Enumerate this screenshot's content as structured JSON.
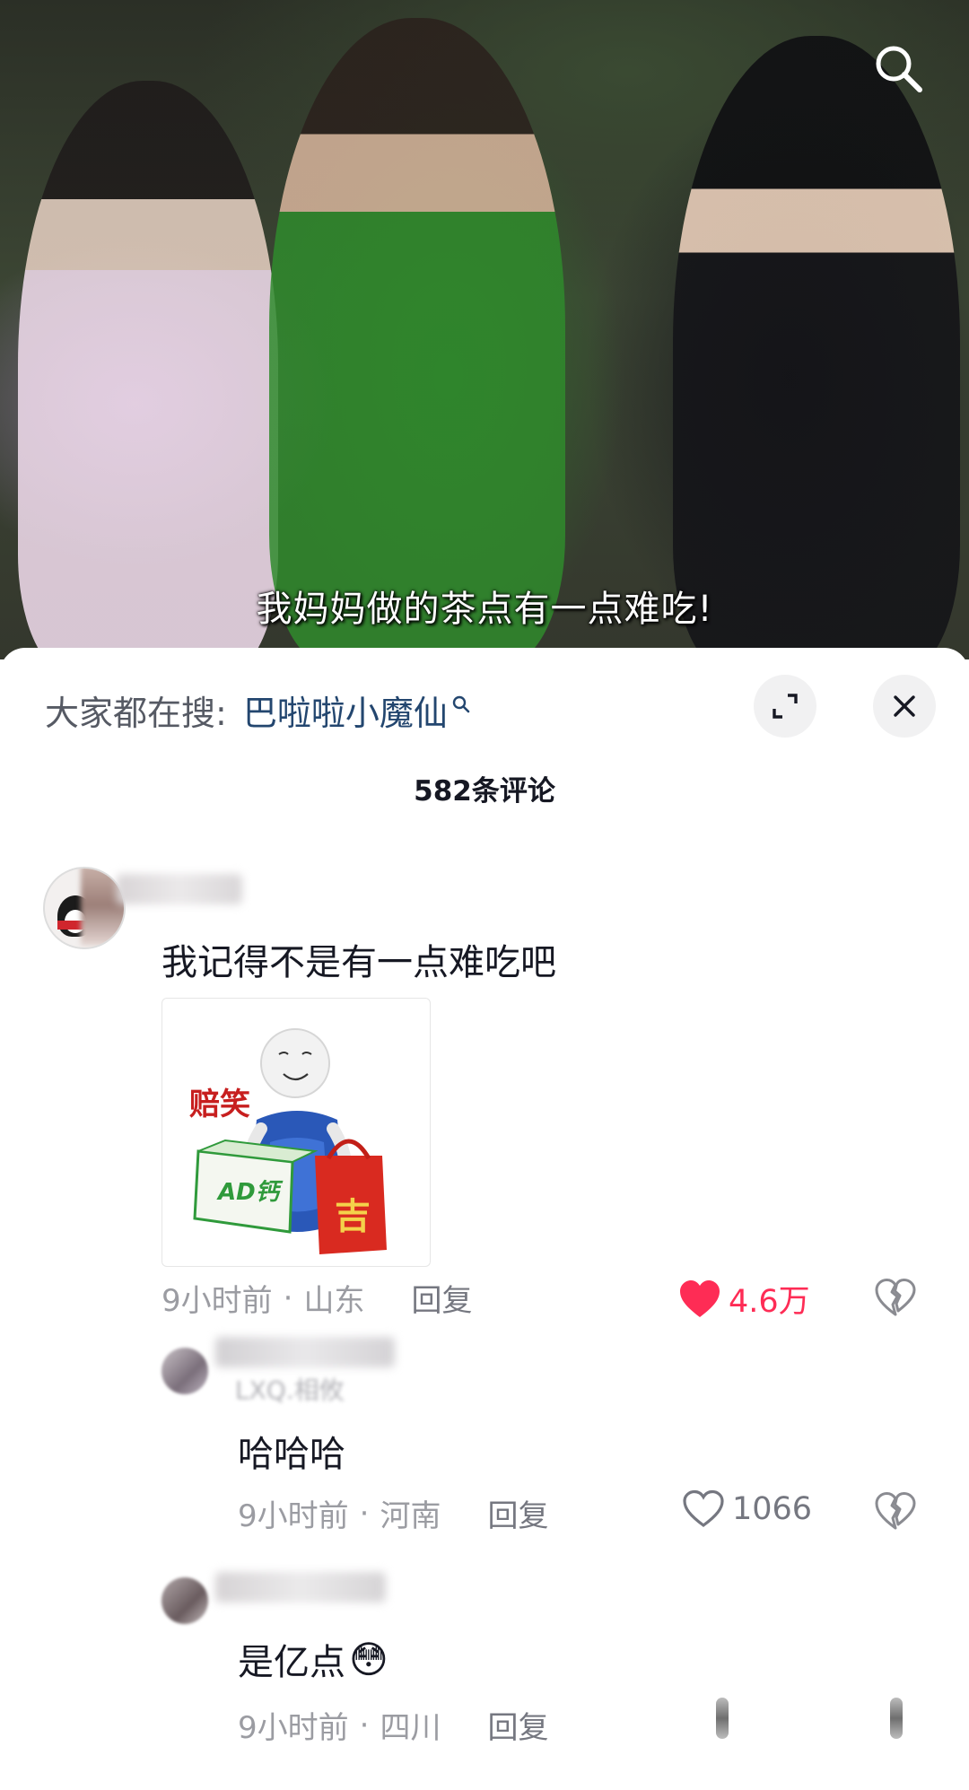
{
  "video": {
    "subtitle": "我妈妈做的茶点有一点难吃!",
    "search_icon": "search-icon"
  },
  "sheet": {
    "hot_search_label": "大家都在搜:",
    "hot_search_term": "巴啦啦小魔仙",
    "comment_count": "582条评论"
  },
  "comments": [
    {
      "text": "我记得不是有一点难吃吧",
      "sticker_text": "赔笑",
      "sticker_box_brand": "AD钙",
      "sticker_bag_char": "吉",
      "time": "9小时前",
      "location": "山东",
      "reply": "回复",
      "likes": "4.6万",
      "liked": true,
      "like_color": "#fe2c55"
    }
  ],
  "replies": [
    {
      "name": "LXQ.相攸",
      "text": "哈哈哈",
      "time": "9小时前",
      "location": "河南",
      "reply": "回复",
      "likes": "1066"
    },
    {
      "text": "是亿点",
      "emoji": "😳",
      "time": "9小时前",
      "location": "四川",
      "reply": "回复"
    }
  ],
  "separator": "·"
}
